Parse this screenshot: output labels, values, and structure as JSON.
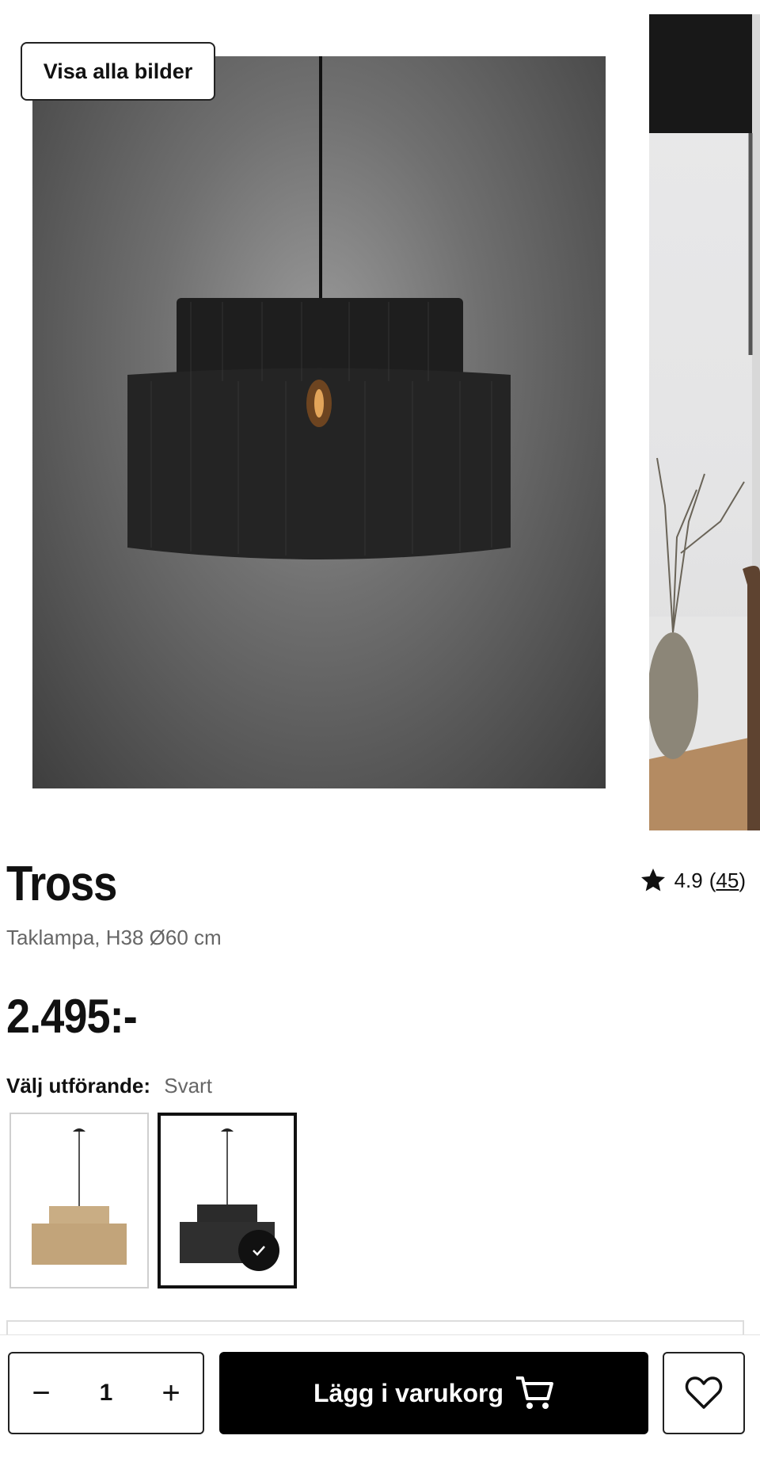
{
  "gallery": {
    "show_all_label": "Visa alla bilder"
  },
  "product": {
    "title": "Tross",
    "rating": "4.9",
    "review_count": "45",
    "subtitle": "Taklampa, H38 Ø60 cm",
    "price": "2.495:-"
  },
  "variant": {
    "label": "Välj utförande:",
    "selected": "Svart"
  },
  "purchase": {
    "quantity": "1",
    "minus_symbol": "−",
    "plus_symbol": "+",
    "add_to_cart_label": "Lägg i varukorg"
  },
  "colors": {
    "accent": "#000000",
    "natural_swatch": "#c9ad84",
    "black_swatch": "#2b2b2b"
  }
}
